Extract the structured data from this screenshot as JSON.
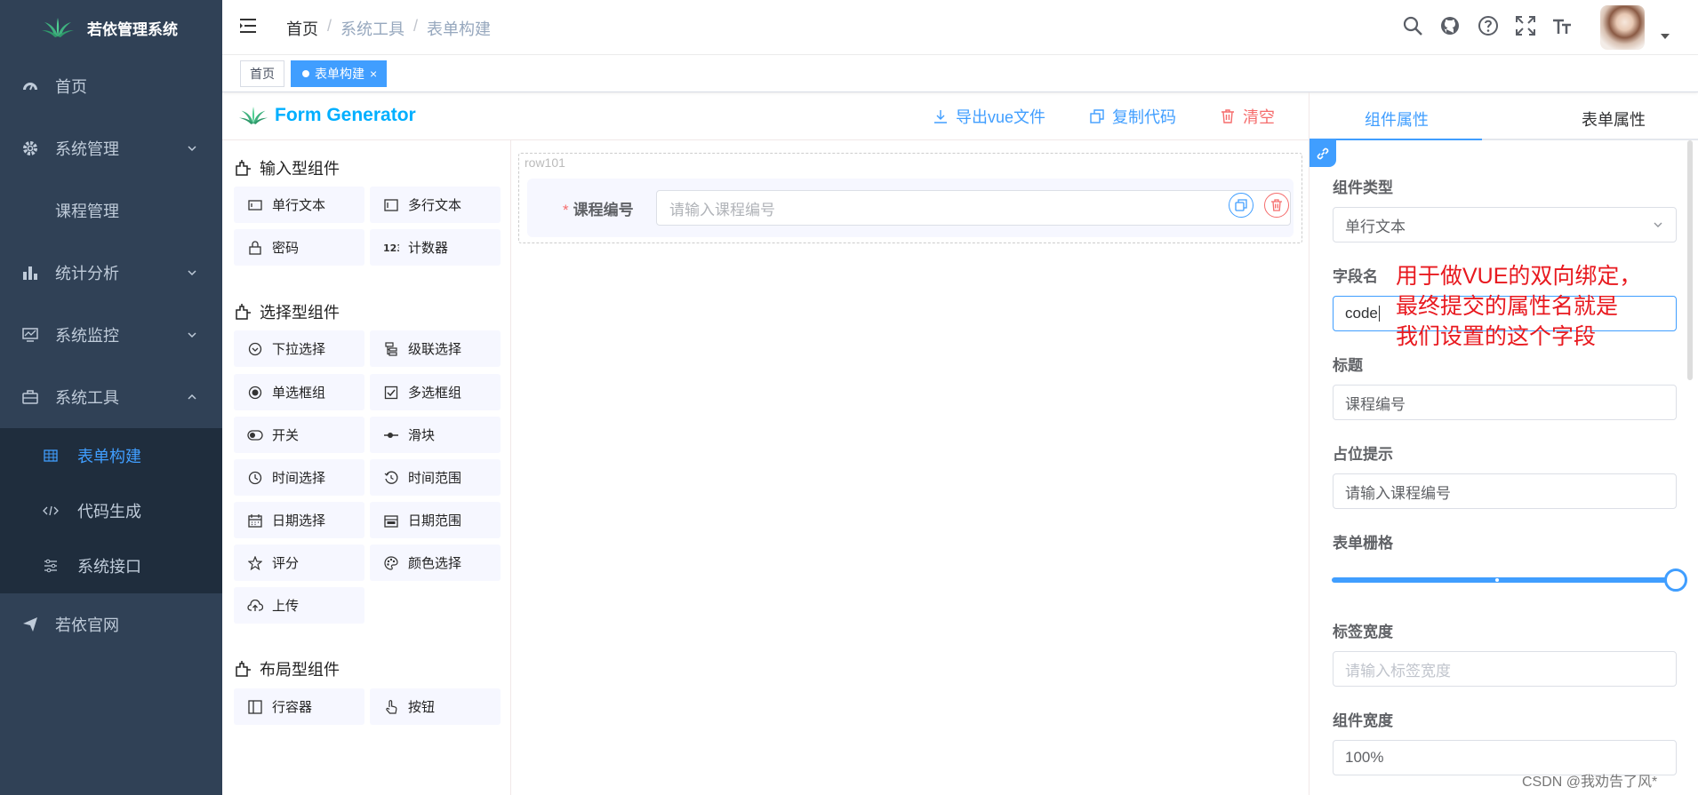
{
  "app": {
    "title": "若依管理系统"
  },
  "sidebar": {
    "items": [
      {
        "label": "首页",
        "icon": "dashboard-icon"
      },
      {
        "label": "系统管理",
        "icon": "gear-icon"
      },
      {
        "label": "课程管理"
      },
      {
        "label": "统计分析",
        "icon": "bar-chart-icon"
      },
      {
        "label": "系统监控",
        "icon": "monitor-icon"
      },
      {
        "label": "系统工具",
        "icon": "toolbox-icon"
      },
      {
        "label": "若依官网",
        "icon": "send-icon"
      }
    ],
    "sub_items": [
      {
        "label": "表单构建",
        "icon": "table-icon",
        "active": true
      },
      {
        "label": "代码生成",
        "icon": "code-icon"
      },
      {
        "label": "系统接口",
        "icon": "sliders-icon"
      }
    ]
  },
  "breadcrumb": [
    "首页",
    "系统工具",
    "表单构建"
  ],
  "breadcrumb_sep": "/",
  "tags": [
    {
      "label": "首页"
    },
    {
      "label": "表单构建",
      "close": "×"
    }
  ],
  "generator": {
    "title": "Form Generator",
    "actions": {
      "export": "导出vue文件",
      "copy": "复制代码",
      "clear": "清空"
    },
    "groups": [
      {
        "title": "输入型组件",
        "items": [
          "单行文本",
          "多行文本",
          "密码",
          "计数器"
        ]
      },
      {
        "title": "选择型组件",
        "items": [
          "下拉选择",
          "级联选择",
          "单选框组",
          "多选框组",
          "开关",
          "滑块",
          "时间选择",
          "时间范围",
          "日期选择",
          "日期范围",
          "评分",
          "颜色选择",
          "上传"
        ]
      },
      {
        "title": "布局型组件",
        "items": [
          "行容器",
          "按钮"
        ]
      }
    ],
    "canvas": {
      "row_label": "row101",
      "field_required": "*",
      "field_label": "课程编号",
      "field_placeholder": "请输入课程编号"
    }
  },
  "right_panel": {
    "tabs": [
      "组件属性",
      "表单属性"
    ],
    "fields": {
      "type_label": "组件类型",
      "type_value": "单行文本",
      "field_label": "字段名",
      "field_value": "code",
      "title_label": "标题",
      "title_value": "课程编号",
      "placeholder_label": "占位提示",
      "placeholder_value": "请输入课程编号",
      "grid_label": "表单栅格",
      "grid_value": 1.0,
      "label_width_label": "标签宽度",
      "label_width_placeholder": "请输入标签宽度",
      "width_label": "组件宽度",
      "width_value": "100%"
    },
    "annotation": [
      "用于做VUE的双向绑定，",
      "最终提交的属性名就是",
      "我们设置的这个字段"
    ]
  },
  "watermark": "CSDN @我劝告了风*",
  "colors": {
    "primary": "#409eff",
    "danger": "#f56c6c",
    "sidebar": "#304156",
    "title": "#00afff",
    "annotation": "#e8191f"
  }
}
